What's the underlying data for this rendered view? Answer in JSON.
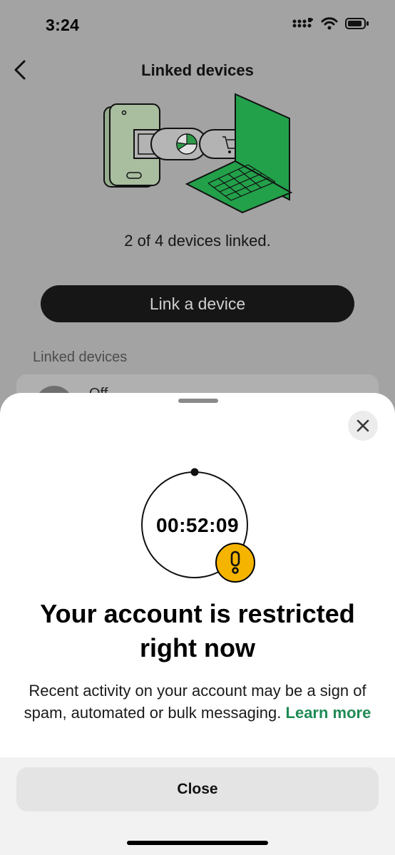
{
  "status_bar": {
    "time": "3:24",
    "icons": [
      "signal-icon",
      "wifi-icon",
      "battery-icon"
    ]
  },
  "nav": {
    "back_icon": "chevron-left-icon",
    "title": "Linked devices"
  },
  "summary": {
    "devices_linked_text": "2 of 4 devices linked."
  },
  "link_button": {
    "label": "Link a device"
  },
  "linked_list": {
    "header": "Linked devices",
    "items": [
      {
        "name": "Off"
      }
    ]
  },
  "sheet": {
    "close_icon": "close-icon",
    "timer": "00:52:09",
    "warning_icon": "exclamation-icon",
    "headline_line1": "Your account is restricted",
    "headline_line2": "right now",
    "body": "Recent activity on your account may be a sign of spam, automated or bulk messaging.",
    "learn_more": "Learn more",
    "close_button": "Close"
  },
  "colors": {
    "accent_green": "#1f8a55",
    "warning_yellow": "#f5b400",
    "dim_overlay": "#a3a3a3"
  }
}
